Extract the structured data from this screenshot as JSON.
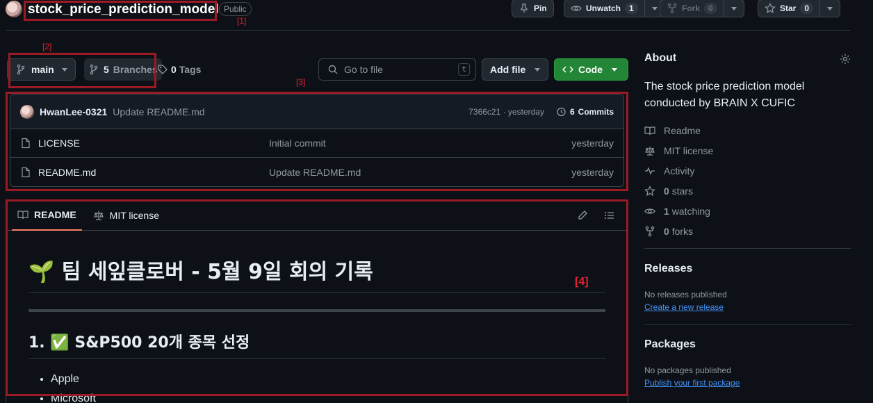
{
  "repo": {
    "name": "stock_price_prediction_model",
    "visibility": "Public"
  },
  "header_actions": {
    "pin": "Pin",
    "unwatch": "Unwatch",
    "unwatch_count": "1",
    "fork": "Fork",
    "fork_count": "0",
    "star": "Star",
    "star_count": "0"
  },
  "toolbar": {
    "branch": "main",
    "branches_count": "5",
    "branches_label": "Branches",
    "tags_count": "0",
    "tags_label": "Tags",
    "search_placeholder": "Go to file",
    "search_shortcut": "t",
    "add_file": "Add file",
    "code": "Code"
  },
  "latest_commit": {
    "author": "HwanLee-0321",
    "message": "Update README.md",
    "hash_time": "7366c21 · yesterday",
    "commits_count": "6",
    "commits_label": "Commits"
  },
  "files": [
    {
      "name": "LICENSE",
      "commit": "Initial commit",
      "time": "yesterday"
    },
    {
      "name": "README.md",
      "commit": "Update README.md",
      "time": "yesterday"
    }
  ],
  "readme": {
    "tab_readme": "README",
    "tab_license": "MIT license",
    "h1": "🌱 팀 세잎클로버 - 5월 9일 회의 기록",
    "h2": "1. ✅ S&P500 20개 종목 선정",
    "list": [
      "Apple",
      "Microsoft"
    ]
  },
  "about": {
    "title": "About",
    "description": "The stock price prediction model conducted by BRAIN X CUFIC",
    "readme": "Readme",
    "license": "MIT license",
    "activity": "Activity",
    "stars_count": "0",
    "stars_label": "stars",
    "watching_count": "1",
    "watching_label": "watching",
    "forks_count": "0",
    "forks_label": "forks"
  },
  "releases": {
    "title": "Releases",
    "none": "No releases published",
    "link": "Create a new release"
  },
  "packages": {
    "title": "Packages",
    "none": "No packages published",
    "link": "Publish your first package"
  },
  "annotations": [
    "[1]",
    "[2]",
    "[3]",
    "[4]"
  ]
}
